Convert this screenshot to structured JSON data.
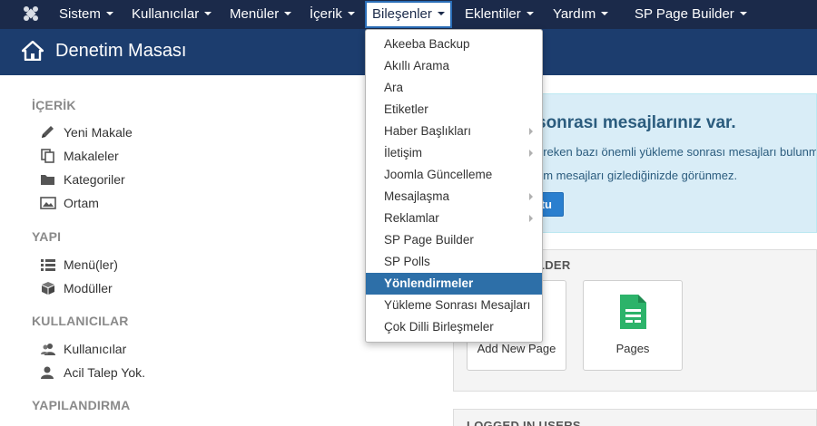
{
  "nav": {
    "items": [
      {
        "label": "Sistem"
      },
      {
        "label": "Kullanıcılar"
      },
      {
        "label": "Menüler"
      },
      {
        "label": "İçerik"
      },
      {
        "label": "Bileşenler"
      },
      {
        "label": "Eklentiler"
      },
      {
        "label": "Yardım"
      },
      {
        "label": "SP Page Builder"
      }
    ]
  },
  "header": {
    "title": "Denetim Masası"
  },
  "sidebar": {
    "sections": [
      {
        "title": "İÇERİK",
        "items": [
          {
            "label": "Yeni Makale",
            "icon": "pencil-icon"
          },
          {
            "label": "Makaleler",
            "icon": "copy-icon"
          },
          {
            "label": "Kategoriler",
            "icon": "folder-icon"
          },
          {
            "label": "Ortam",
            "icon": "image-icon"
          }
        ]
      },
      {
        "title": "YAPI",
        "items": [
          {
            "label": "Menü(ler)",
            "icon": "list-icon"
          },
          {
            "label": "Modüller",
            "icon": "cube-icon"
          }
        ]
      },
      {
        "title": "KULLANICILAR",
        "items": [
          {
            "label": "Kullanıcılar",
            "icon": "users-icon"
          },
          {
            "label": "Acil Talep Yok.",
            "icon": "user-icon"
          }
        ]
      },
      {
        "title": "YAPILANDIRMA",
        "items": []
      }
    ]
  },
  "alert": {
    "title": "sonrası mesajlarınız var.",
    "line1": "ereken bazı önemli yükleme sonrası mesajları bulunm",
    "line2": "üm mesajları gizlediğinizde görünmez.",
    "button": "tu"
  },
  "spbuilder": {
    "title": "LDER",
    "cards": [
      {
        "label": "Add New Page"
      },
      {
        "label": "Pages"
      }
    ]
  },
  "logged": {
    "title": "LOGGED IN USERS"
  },
  "dropdown": {
    "items": [
      {
        "label": "Akeeba Backup",
        "submenu": false
      },
      {
        "label": "Akıllı Arama",
        "submenu": false
      },
      {
        "label": "Ara",
        "submenu": false
      },
      {
        "label": "Etiketler",
        "submenu": false
      },
      {
        "label": "Haber Başlıkları",
        "submenu": true
      },
      {
        "label": "İletişim",
        "submenu": true
      },
      {
        "label": "Joomla Güncelleme",
        "submenu": false
      },
      {
        "label": "Mesajlaşma",
        "submenu": true
      },
      {
        "label": "Reklamlar",
        "submenu": true
      },
      {
        "label": "SP Page Builder",
        "submenu": false
      },
      {
        "label": "SP Polls",
        "submenu": false
      },
      {
        "label": "Yönlendirmeler",
        "submenu": false,
        "highlighted": true
      },
      {
        "label": "Yükleme Sonrası Mesajları",
        "submenu": false
      },
      {
        "label": "Çok Dilli Birleşmeler",
        "submenu": false
      }
    ]
  },
  "colors": {
    "topnav": "#1b2a4a",
    "header": "#1c3d6e",
    "highlight": "#2d6fa8",
    "alert_bg": "#d9edf7"
  }
}
